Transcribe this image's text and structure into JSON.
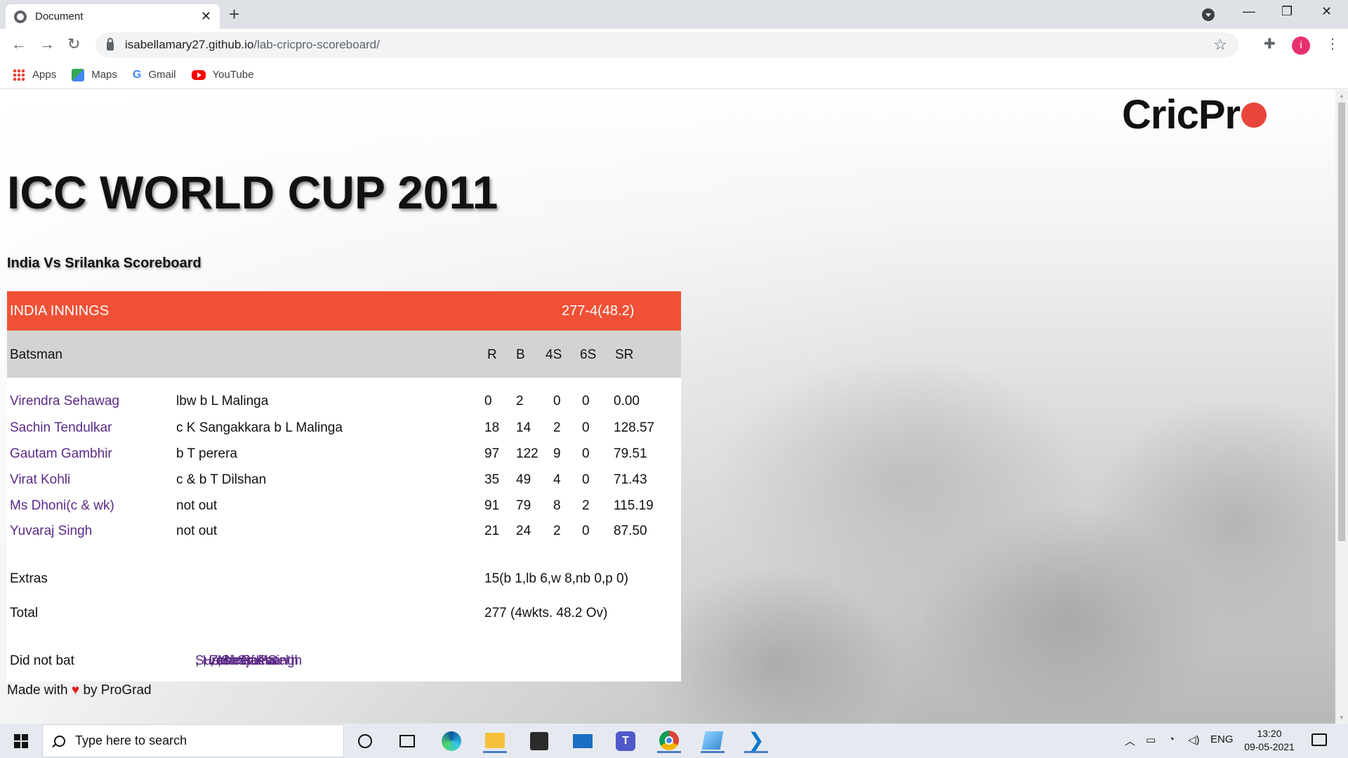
{
  "browser": {
    "tab_title": "Document",
    "tab_close": "✕",
    "new_tab": "+",
    "url_host": "isabellamary27.github.io",
    "url_path": "/lab-cricpro-scoreboard/",
    "profile_initial": "i",
    "minimize": "—",
    "restore": "❐",
    "close": "✕",
    "bookmarks": [
      {
        "label": "Apps",
        "icon": "apps-grid-icon"
      },
      {
        "label": "Maps",
        "icon": "maps-icon"
      },
      {
        "label": "Gmail",
        "icon": "google-g-icon"
      },
      {
        "label": "YouTube",
        "icon": "youtube-icon"
      }
    ]
  },
  "page": {
    "logo_text": "CricPr",
    "title": "ICC WORLD CUP 2011",
    "subtitle": "India Vs Srilanka Scoreboard",
    "innings": {
      "label": "INDIA INNINGS",
      "score": "277-4(48.2)"
    },
    "columns": {
      "batsman": "Batsman",
      "r": "R",
      "b": "B",
      "fours": "4S",
      "sixes": "6S",
      "sr": "SR"
    },
    "batsmen": [
      {
        "name": "Virendra Sehawag",
        "dismissal": "lbw b L Malinga",
        "r": "0",
        "b": "2",
        "fours": "0",
        "sixes": "0",
        "sr": "0.00"
      },
      {
        "name": "Sachin Tendulkar",
        "dismissal": "c K Sangakkara b L Malinga",
        "r": "18",
        "b": "14",
        "fours": "2",
        "sixes": "0",
        "sr": "128.57"
      },
      {
        "name": "Gautam Gambhir",
        "dismissal": "b T perera",
        "r": "97",
        "b": "122",
        "fours": "9",
        "sixes": "0",
        "sr": "79.51"
      },
      {
        "name": "Virat Kohli",
        "dismissal": "c & b T Dilshan",
        "r": "35",
        "b": "49",
        "fours": "4",
        "sixes": "0",
        "sr": "71.43"
      },
      {
        "name": "Ms Dhoni(c & wk)",
        "dismissal": "not out",
        "r": "91",
        "b": "79",
        "fours": "8",
        "sixes": "2",
        "sr": "115.19"
      },
      {
        "name": "Yuvaraj Singh",
        "dismissal": "not out",
        "r": "21",
        "b": "24",
        "fours": "2",
        "sixes": "0",
        "sr": "87.50"
      }
    ],
    "extras_label": "Extras",
    "extras_value": "15(b 1,lb 6,w 8,nb 0,p 0)",
    "total_label": "Total",
    "total_value": "277 (4wkts. 48.2 Ov)",
    "did_not_bat_label": "Did not bat",
    "did_not_bat": [
      "Suresh Raina",
      "Harbhajan Singh",
      "Zaheer Khan",
      "Munaf Patel",
      "S. Sreesanth"
    ],
    "footer_prefix": "Made with",
    "footer_heart": "♥",
    "footer_suffix": "by ProGrad"
  },
  "taskbar": {
    "search_placeholder": "Type here to search",
    "language": "ENG",
    "time": "13:20",
    "date": "09-05-2021"
  },
  "colors": {
    "innings_header": "#f05136",
    "column_header": "#d3d3d3",
    "player_link": "#5b2a86",
    "heart": "#e01e1e"
  }
}
